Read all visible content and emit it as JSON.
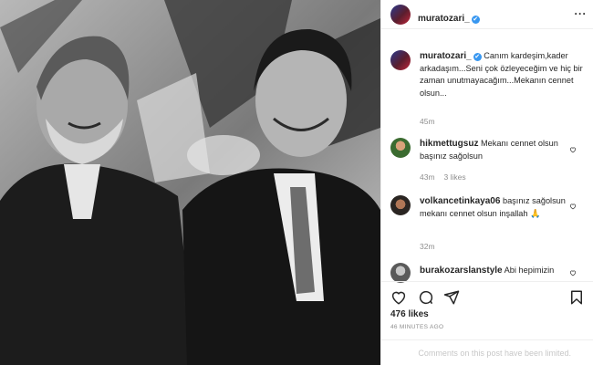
{
  "post": {
    "username": "muratozari_",
    "verified_mark": "✔",
    "more_icon": "more-horizontal-icon",
    "caption": "Canım kardeşim,kader arkadaşım...Seni çok özleyeceğim ve hiç bir zaman unutmayacağım...Mekanın cennet olsun...",
    "caption_time": "45m",
    "likes": "476 likes",
    "posted_ago": "46 MINUTES AGO",
    "comments_limited": "Comments on this post have been limited."
  },
  "comments": [
    {
      "username": "hikmettugsuz",
      "text": "Mekanı cennet olsun başınız sağolsun",
      "time": "43m",
      "likes": "3 likes"
    },
    {
      "username": "volkancetinkaya06",
      "text": "başınız sağolsun mekanı cennet olsun inşallah 🙏",
      "time": "32m"
    },
    {
      "username": "burakozarslanstyle",
      "text": "Abi hepimizin"
    }
  ],
  "icons": {
    "like": "heart-icon",
    "comment": "comment-icon",
    "share": "send-icon",
    "save": "bookmark-icon"
  },
  "colors": {
    "link_blue": "#3897f0",
    "muted_gray": "#8e8e8e",
    "divider": "#efefef"
  }
}
